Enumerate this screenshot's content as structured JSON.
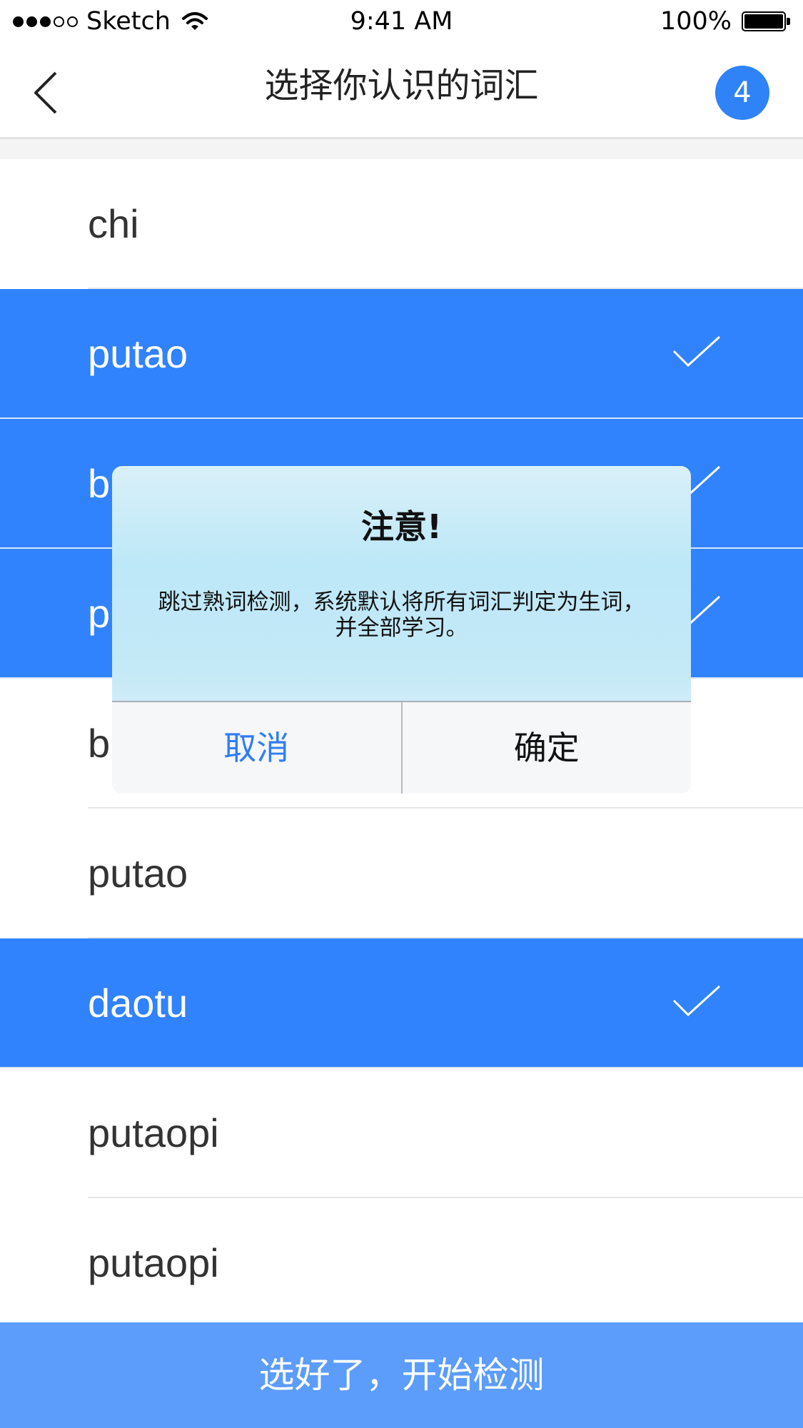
{
  "status_bar": {
    "carrier": "Sketch",
    "time": "9:41 AM",
    "battery": "100%",
    "signal_bars_filled": 3,
    "signal_bars_total": 5
  },
  "nav": {
    "title": "选择你认识的词汇",
    "badge_count": "4"
  },
  "words": [
    {
      "label": "chi",
      "selected": false
    },
    {
      "label": "putao",
      "selected": true
    },
    {
      "label": "b",
      "selected": true
    },
    {
      "label": "p",
      "selected": true
    },
    {
      "label": "b",
      "selected": false
    },
    {
      "label": "putao",
      "selected": false
    },
    {
      "label": "daotu",
      "selected": true
    },
    {
      "label": "putaopi",
      "selected": false
    },
    {
      "label": "putaopi",
      "selected": false
    }
  ],
  "start_button": {
    "label": "选好了，开始检测"
  },
  "alert": {
    "title": "注意!",
    "message": "跳过熟词检测，系统默认将所有词汇判定为生词，并全部学习。",
    "cancel_label": "取消",
    "confirm_label": "确定"
  },
  "colors": {
    "accent": "#3182FD",
    "selected_row": "#3182FD",
    "start_button": "#5C9CFB",
    "cancel_text": "#2F7DF4"
  }
}
